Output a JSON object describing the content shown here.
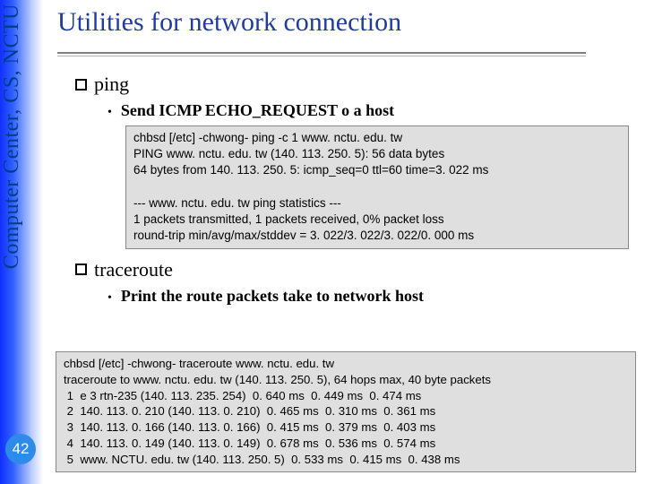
{
  "sidebar": {
    "org_label": "Computer Center, CS, NCTU",
    "page_number": "42"
  },
  "title": "Utilities for network connection",
  "sections": {
    "ping": {
      "heading": "ping",
      "sub": "Send ICMP ECHO_REQUEST o a host",
      "code": "chbsd [/etc] -chwong- ping -c 1 www. nctu. edu. tw\nPING www. nctu. edu. tw (140. 113. 250. 5): 56 data bytes\n64 bytes from 140. 113. 250. 5: icmp_seq=0 ttl=60 time=3. 022 ms\n\n--- www. nctu. edu. tw ping statistics ---\n1 packets transmitted, 1 packets received, 0% packet loss\nround-trip min/avg/max/stddev = 3. 022/3. 022/3. 022/0. 000 ms"
    },
    "traceroute": {
      "heading": "traceroute",
      "sub": "Print the route packets take to network host",
      "code": "chbsd [/etc] -chwong- traceroute www. nctu. edu. tw\ntraceroute to www. nctu. edu. tw (140. 113. 250. 5), 64 hops max, 40 byte packets\n 1  e 3 rtn-235 (140. 113. 235. 254)  0. 640 ms  0. 449 ms  0. 474 ms\n 2  140. 113. 0. 210 (140. 113. 0. 210)  0. 465 ms  0. 310 ms  0. 361 ms\n 3  140. 113. 0. 166 (140. 113. 0. 166)  0. 415 ms  0. 379 ms  0. 403 ms\n 4  140. 113. 0. 149 (140. 113. 0. 149)  0. 678 ms  0. 536 ms  0. 574 ms\n 5  www. NCTU. edu. tw (140. 113. 250. 5)  0. 533 ms  0. 415 ms  0. 438 ms"
    }
  }
}
